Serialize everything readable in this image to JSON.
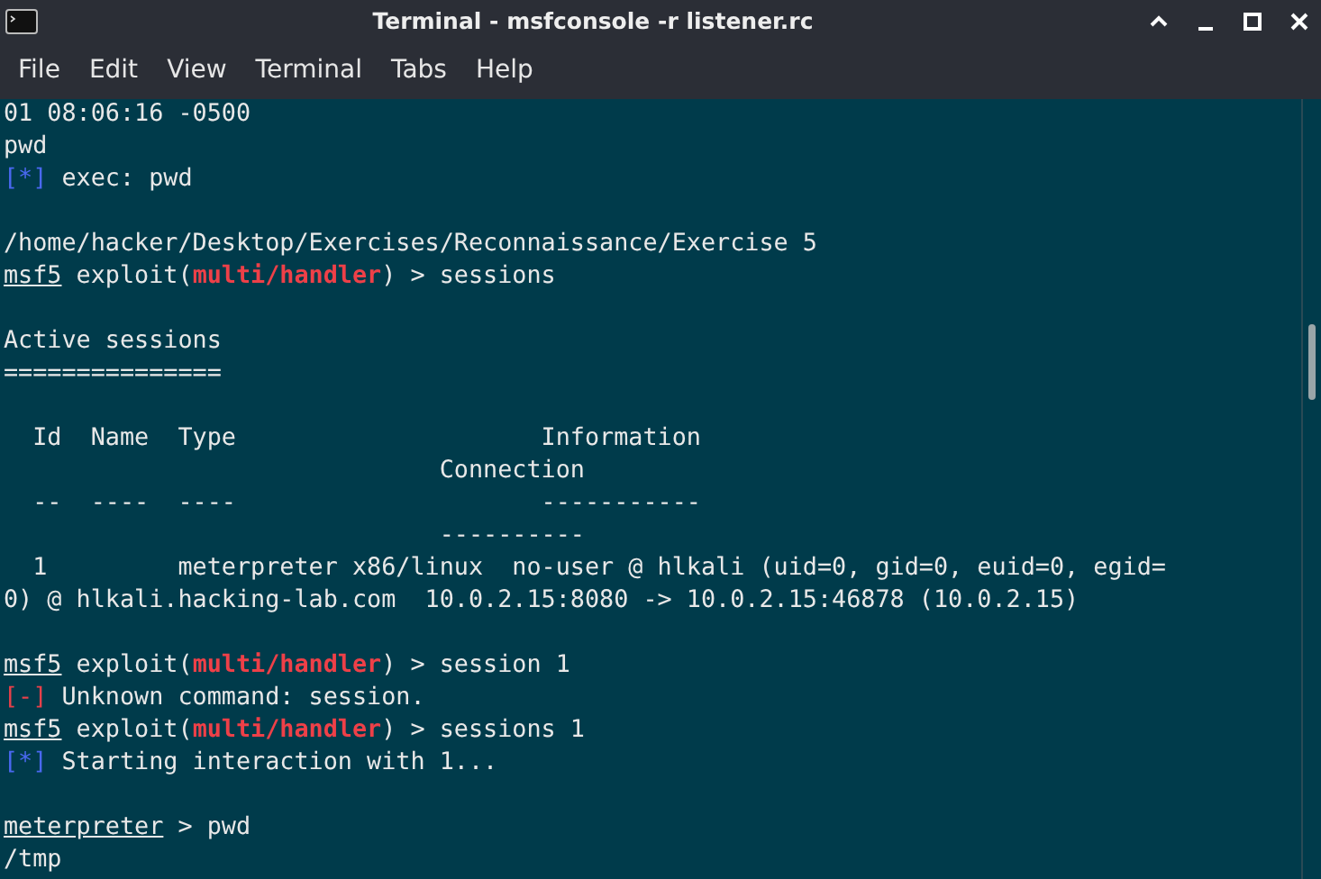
{
  "window": {
    "title": "Terminal - msfconsole -r listener.rc"
  },
  "menu": [
    "File",
    "Edit",
    "View",
    "Terminal",
    "Tabs",
    "Help"
  ],
  "terminal": {
    "lines": [
      {
        "kind": "text",
        "segments": [
          {
            "kind": "plain",
            "text": "01 08:06:16 -0500"
          }
        ]
      },
      {
        "kind": "text",
        "segments": [
          {
            "kind": "plain",
            "text": "pwd"
          }
        ]
      },
      {
        "kind": "text",
        "segments": [
          {
            "kind": "info",
            "text": "[*]"
          },
          {
            "kind": "plain",
            "text": " exec: pwd"
          }
        ]
      },
      {
        "kind": "blank"
      },
      {
        "kind": "text",
        "segments": [
          {
            "kind": "plain",
            "text": "/home/hacker/Desktop/Exercises/Reconnaissance/Exercise 5"
          }
        ]
      },
      {
        "kind": "text",
        "segments": [
          {
            "kind": "prompt",
            "text": "msf5"
          },
          {
            "kind": "plain",
            "text": " exploit("
          },
          {
            "kind": "module",
            "text": "multi/handler"
          },
          {
            "kind": "plain",
            "text": ") > sessions"
          }
        ]
      },
      {
        "kind": "blank"
      },
      {
        "kind": "text",
        "segments": [
          {
            "kind": "plain",
            "text": "Active sessions"
          }
        ]
      },
      {
        "kind": "text",
        "segments": [
          {
            "kind": "plain",
            "text": "==============="
          }
        ]
      },
      {
        "kind": "blank"
      },
      {
        "kind": "text",
        "segments": [
          {
            "kind": "plain",
            "text": "  Id  Name  Type                     Information"
          }
        ]
      },
      {
        "kind": "text",
        "segments": [
          {
            "kind": "plain",
            "text": "                              Connection"
          }
        ]
      },
      {
        "kind": "text",
        "segments": [
          {
            "kind": "plain",
            "text": "  --  ----  ----                     -----------"
          }
        ]
      },
      {
        "kind": "text",
        "segments": [
          {
            "kind": "plain",
            "text": "                              ----------"
          }
        ]
      },
      {
        "kind": "text",
        "segments": [
          {
            "kind": "plain",
            "text": "  1         meterpreter x86/linux  no-user @ hlkali (uid=0, gid=0, euid=0, egid="
          }
        ]
      },
      {
        "kind": "text",
        "segments": [
          {
            "kind": "plain",
            "text": "0) @ hlkali.hacking-lab.com  10.0.2.15:8080 -> 10.0.2.15:46878 (10.0.2.15)"
          }
        ]
      },
      {
        "kind": "blank"
      },
      {
        "kind": "text",
        "segments": [
          {
            "kind": "prompt",
            "text": "msf5"
          },
          {
            "kind": "plain",
            "text": " exploit("
          },
          {
            "kind": "module",
            "text": "multi/handler"
          },
          {
            "kind": "plain",
            "text": ") > session 1"
          }
        ]
      },
      {
        "kind": "text",
        "segments": [
          {
            "kind": "error",
            "text": "[-]"
          },
          {
            "kind": "plain",
            "text": " Unknown command: session."
          }
        ]
      },
      {
        "kind": "text",
        "segments": [
          {
            "kind": "prompt",
            "text": "msf5"
          },
          {
            "kind": "plain",
            "text": " exploit("
          },
          {
            "kind": "module",
            "text": "multi/handler"
          },
          {
            "kind": "plain",
            "text": ") > sessions 1"
          }
        ]
      },
      {
        "kind": "text",
        "segments": [
          {
            "kind": "info",
            "text": "[*]"
          },
          {
            "kind": "plain",
            "text": " Starting interaction with 1..."
          }
        ]
      },
      {
        "kind": "blank"
      },
      {
        "kind": "text",
        "segments": [
          {
            "kind": "prompt",
            "text": "meterpreter"
          },
          {
            "kind": "plain",
            "text": " > pwd"
          }
        ]
      },
      {
        "kind": "text",
        "segments": [
          {
            "kind": "plain",
            "text": "/tmp"
          }
        ]
      }
    ]
  }
}
